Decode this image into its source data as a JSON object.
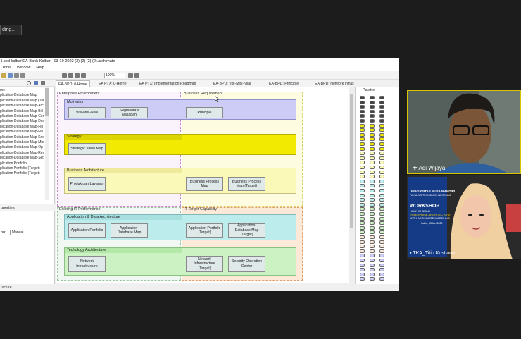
{
  "toast": {
    "text": "ding..."
  },
  "window": {
    "title": "l.bpd-kalbar\\EA-Bank-Kalbar - 03-10-2022 (3) (2) (2) (2).archimate",
    "menu": [
      "Tools",
      "Window",
      "Help"
    ],
    "zoom": "100%"
  },
  "tree": {
    "items": [
      "me",
      "plication-Database Map",
      "plication-Database Map (Tar",
      "plication-Database Map-Arc",
      "plication-Database Map-Bill",
      "plication-Database Map-Cor",
      "plication-Database Map-Dcc",
      "plication-Database Map-Fin",
      "plication-Database Map-Fin",
      "plication-Database Map-Kre",
      "plication-Database Map-Mic",
      "plication-Database Map-Op",
      "plication-Database Map-Res",
      "plication-Database Map-Sett",
      "plication Portfolio",
      "plication Portfolio (Target)",
      "plication Portfolio (Target)"
    ]
  },
  "properties": {
    "title": "operties",
    "label": "on:",
    "value": "Manual"
  },
  "status": {
    "text": "ructure"
  },
  "tabs": [
    "EA-BPD: 0-Home",
    "EA PTX: 0-Home",
    "EA PTX: Implementation Roadmap",
    "EA-BPD: Visi-Misi-Nilai",
    "EA-BPD: Principle",
    "EA-BPD: Network Infrastructure"
  ],
  "diagram": {
    "enterprise_environment": "Enterprise Environment",
    "business_requirement": "Business Requirement",
    "existing_it_performance": "Existing IT Performance",
    "it_target_capability": "IT Target Capability",
    "layers": {
      "motivation": "Motivation",
      "strategy": "Strategy",
      "business_architecture": "Business Architecture",
      "app_data_architecture": "Application & Data Architecture",
      "tech_architecture": "Techology Architecture"
    },
    "elements": {
      "visi_misi_nilai": "Visi-Misi-Nilai",
      "segmentasi_nasabah": "Segmentasi Nasabah",
      "principle": "Principle",
      "strategic_value_map": "Strategic Value Map",
      "produk_layanan": "Produk dan Layanan",
      "bpm": "Business Process Map",
      "bpm_target": "Business Process Map (Target)",
      "app_portfolio": "Application Portfolio",
      "app_db_map": "Application-Database Map",
      "app_portfolio_target": "Application Portfolio (Target)",
      "app_db_map_target": "Application-Database Map (Target)",
      "network_infra": "Network Infrastructure",
      "network_infra_target": "Network Infrastructure (Target)",
      "security_ops": "Security Operation Center"
    }
  },
  "palette": {
    "title": "Palette"
  },
  "participants": {
    "p1": "Adi Wijaya",
    "p2": "TKA_Titin Kristiana"
  },
  "poster": {
    "org": "UNIVERSITAS NUSA MANDIRI",
    "faculty": "FAKULTAS TEKNOLOGI INFORMASI",
    "workshop": "WORKSHOP",
    "subtitle1": "HOW TO BUILD",
    "subtitle2": "ENTERPRISE ARCHITECTURE",
    "subtitle3": "WITH ARCHIMATE MODELING",
    "date": "Sabtu, 13 Mei 2023"
  }
}
